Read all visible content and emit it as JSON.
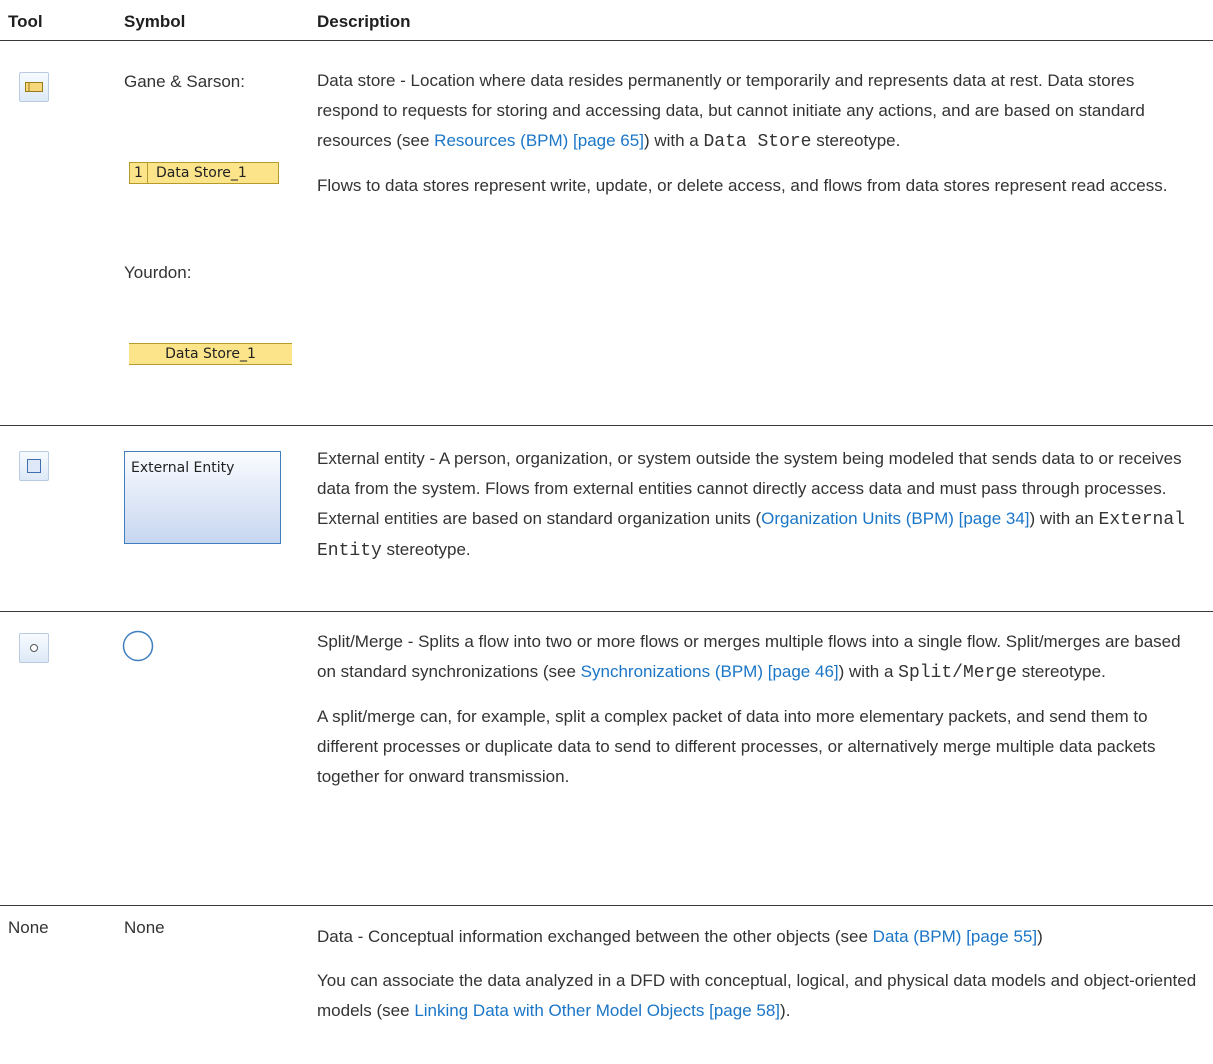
{
  "header": {
    "tool": "Tool",
    "symbol": "Symbol",
    "description": "Description"
  },
  "rows": {
    "data_store": {
      "label_gane": "Gane & Sarson:",
      "label_yourdon": "Yourdon:",
      "gane_number": "1",
      "gane_name": "Data Store_1",
      "yourdon_name": "Data Store_1",
      "p1_a": "Data store - Location where data resides permanently or temporarily and represents data at rest. Data stores respond to requests for storing and accessing data, but cannot initiate any actions, and are based on standard resources (see ",
      "p1_link": "Resources (BPM) [page 65]",
      "p1_b": ") with a ",
      "p1_code": "Data Store",
      "p1_c": " stereotype.",
      "p2": "Flows to data stores represent write, update, or delete access, and flows from data stores represent read access."
    },
    "external_entity": {
      "symbol_label": "External Entity",
      "p1_a": "External entity - A person, organization, or system outside the system being modeled that sends data to or receives data from the system. Flows from external entities cannot directly access data and must pass through processes. External entities are based on standard or­ganization units (",
      "p1_link": "Organization Units (BPM) [page 34]",
      "p1_b": ") with an ",
      "p1_code": "External Entity",
      "p1_c": " ster­eotype."
    },
    "split_merge": {
      "p1_a": "Split/Merge - Splits a flow into two or more flows or merges multiple flows into a single flow. Split/merges are based on standard synchronizations (see ",
      "p1_link": "Synchronizations (BPM) [page 46]",
      "p1_b": ") with a ",
      "p1_code": "Split/Merge",
      "p1_c": " stereotype.",
      "p2": "A split/merge can, for example, split a complex packet of data into more elementary pack­ets, and send them to different processes or duplicate data to send to different processes, or alternatively merge multiple data packets together for onward transmission."
    },
    "data": {
      "tool": "None",
      "symbol": "None",
      "p1_a": "Data - Conceptual information exchanged between the other objects (see ",
      "p1_link": "Data (BPM) [page 55]",
      "p1_b": ")",
      "p2_a": "You can associate the data analyzed in a DFD with conceptual, logical, and physical data models and object-oriented models (see ",
      "p2_link": "Linking Data with Other Model Objects [page 58]",
      "p2_b": ")."
    }
  },
  "colors": {
    "link": "#1b76c7",
    "rule": "#3a3a3a",
    "data_store_fill": "#fbe48a",
    "entity_border": "#3f7fbf"
  }
}
